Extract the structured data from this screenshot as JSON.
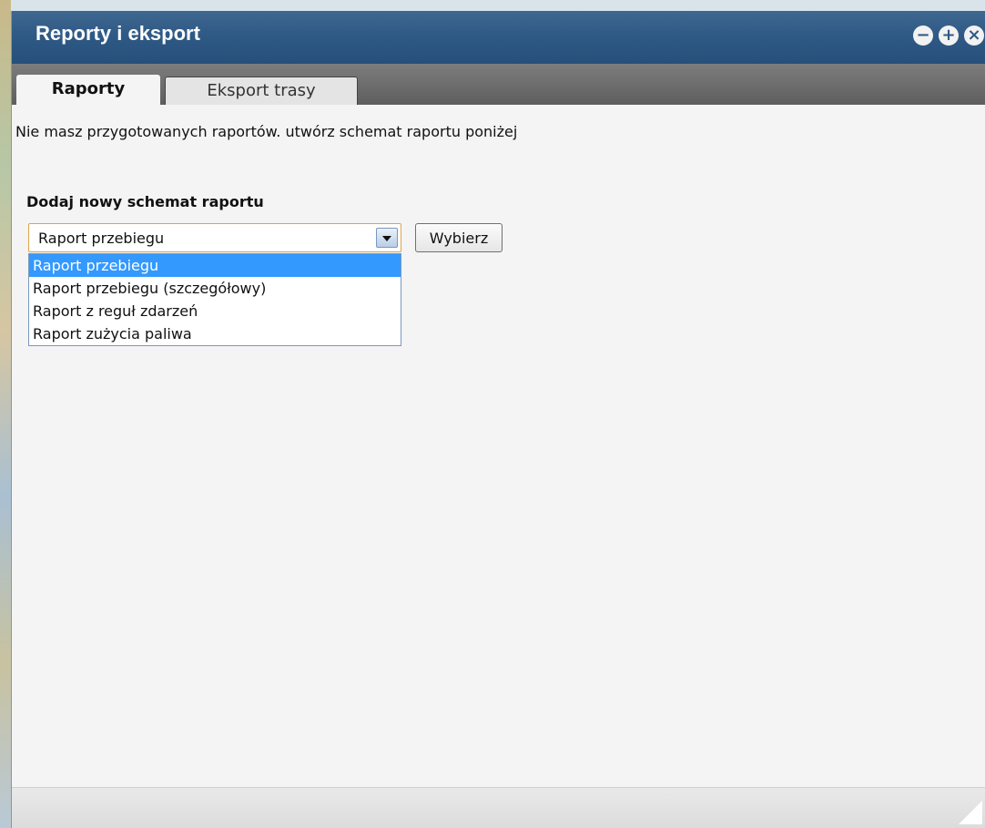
{
  "window": {
    "title": "Reporty i eksport",
    "controls": {
      "minimize_icon": "−",
      "maximize_icon": "+",
      "close_icon": "×"
    }
  },
  "tabs": [
    {
      "label": "Raporty",
      "active": true
    },
    {
      "label": "Eksport trasy",
      "active": false
    }
  ],
  "content": {
    "info_text": "Nie masz przygotowanych raportów. utwórz schemat raportu poniżej",
    "section_heading": "Dodaj nowy schemat raportu",
    "select": {
      "value": "Raport przebiegu",
      "options": [
        "Raport przebiegu",
        "Raport przebiegu (szczegółowy)",
        "Raport z reguł zdarzeń",
        "Raport zużycia paliwa"
      ],
      "selected_index": 0
    },
    "choose_button_label": "Wybierz"
  },
  "colors": {
    "titlebar": "#2f5a86",
    "selected_option": "#3399ff",
    "select_border": "#d9a64a"
  }
}
